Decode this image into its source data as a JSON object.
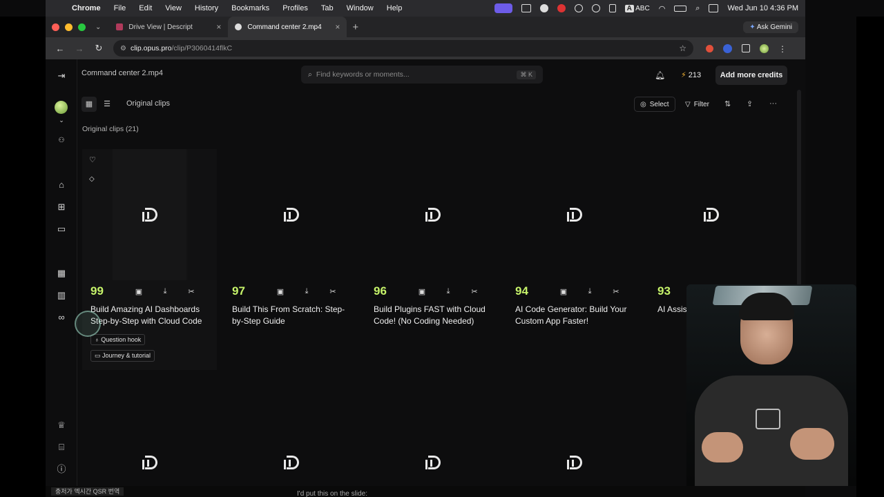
{
  "menubar": {
    "items": [
      "Chrome",
      "File",
      "Edit",
      "View",
      "History",
      "Bookmarks",
      "Profiles",
      "Tab",
      "Window",
      "Help"
    ],
    "input_badge": "ABC",
    "clock": "Wed Jun 10  4:36 PM"
  },
  "browser": {
    "tabs": [
      {
        "title": "Drive View | Descript",
        "active": false
      },
      {
        "title": "Command center 2.mp4",
        "active": true
      }
    ],
    "ask_gemini": "Ask Gemini",
    "url_host": "clip.opus.pro",
    "url_path": "/clip/P3060414flkC"
  },
  "app": {
    "file_title": "Command center 2.mp4",
    "search_placeholder": "Find keywords or moments...",
    "search_shortcut": "⌘ K",
    "credits": "213",
    "add_credits": "Add more credits",
    "tab_label": "Original clips",
    "select_label": "Select",
    "filter_label": "Filter",
    "section_label": "Original clips  (21)"
  },
  "clips": [
    {
      "score": "99",
      "title": "Build Amazing AI Dashboards Step-by-Step with Cloud Code",
      "tags": [
        "Question hook",
        "Journey & tutorial"
      ]
    },
    {
      "score": "97",
      "title": "Build This From Scratch: Step-by-Step Guide",
      "tags": []
    },
    {
      "score": "96",
      "title": "Build Plugins FAST with Cloud Code! (No Coding Needed)",
      "tags": []
    },
    {
      "score": "94",
      "title": "AI Code Generator: Build Your Custom App Faster!",
      "tags": []
    },
    {
      "score": "93",
      "title": "AI Assistant Productivi",
      "tags": []
    }
  ],
  "subtitles": {
    "left": "충저가 엑시간 QSR 번역",
    "center": "I'd put this on the slide:"
  },
  "colors": {
    "score": "#c6f36a",
    "bolt": "#f2b233",
    "background": "#0d0d0e"
  }
}
